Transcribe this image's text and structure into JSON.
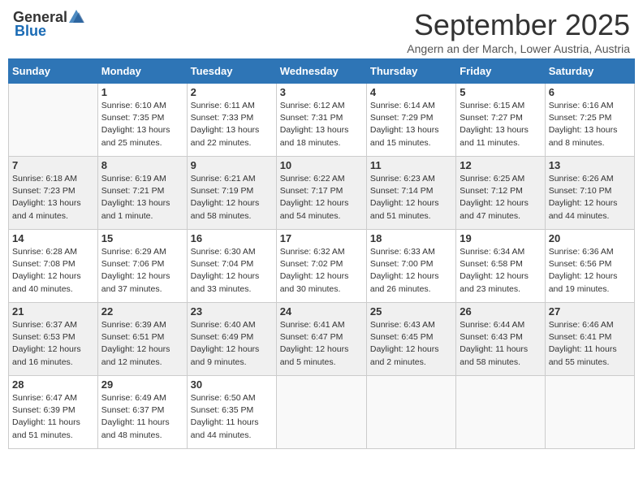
{
  "logo": {
    "general": "General",
    "blue": "Blue"
  },
  "title": "September 2025",
  "subtitle": "Angern an der March, Lower Austria, Austria",
  "days_of_week": [
    "Sunday",
    "Monday",
    "Tuesday",
    "Wednesday",
    "Thursday",
    "Friday",
    "Saturday"
  ],
  "weeks": [
    [
      {
        "day": "",
        "info": ""
      },
      {
        "day": "1",
        "info": "Sunrise: 6:10 AM\nSunset: 7:35 PM\nDaylight: 13 hours\nand 25 minutes."
      },
      {
        "day": "2",
        "info": "Sunrise: 6:11 AM\nSunset: 7:33 PM\nDaylight: 13 hours\nand 22 minutes."
      },
      {
        "day": "3",
        "info": "Sunrise: 6:12 AM\nSunset: 7:31 PM\nDaylight: 13 hours\nand 18 minutes."
      },
      {
        "day": "4",
        "info": "Sunrise: 6:14 AM\nSunset: 7:29 PM\nDaylight: 13 hours\nand 15 minutes."
      },
      {
        "day": "5",
        "info": "Sunrise: 6:15 AM\nSunset: 7:27 PM\nDaylight: 13 hours\nand 11 minutes."
      },
      {
        "day": "6",
        "info": "Sunrise: 6:16 AM\nSunset: 7:25 PM\nDaylight: 13 hours\nand 8 minutes."
      }
    ],
    [
      {
        "day": "7",
        "info": "Sunrise: 6:18 AM\nSunset: 7:23 PM\nDaylight: 13 hours\nand 4 minutes."
      },
      {
        "day": "8",
        "info": "Sunrise: 6:19 AM\nSunset: 7:21 PM\nDaylight: 13 hours\nand 1 minute."
      },
      {
        "day": "9",
        "info": "Sunrise: 6:21 AM\nSunset: 7:19 PM\nDaylight: 12 hours\nand 58 minutes."
      },
      {
        "day": "10",
        "info": "Sunrise: 6:22 AM\nSunset: 7:17 PM\nDaylight: 12 hours\nand 54 minutes."
      },
      {
        "day": "11",
        "info": "Sunrise: 6:23 AM\nSunset: 7:14 PM\nDaylight: 12 hours\nand 51 minutes."
      },
      {
        "day": "12",
        "info": "Sunrise: 6:25 AM\nSunset: 7:12 PM\nDaylight: 12 hours\nand 47 minutes."
      },
      {
        "day": "13",
        "info": "Sunrise: 6:26 AM\nSunset: 7:10 PM\nDaylight: 12 hours\nand 44 minutes."
      }
    ],
    [
      {
        "day": "14",
        "info": "Sunrise: 6:28 AM\nSunset: 7:08 PM\nDaylight: 12 hours\nand 40 minutes."
      },
      {
        "day": "15",
        "info": "Sunrise: 6:29 AM\nSunset: 7:06 PM\nDaylight: 12 hours\nand 37 minutes."
      },
      {
        "day": "16",
        "info": "Sunrise: 6:30 AM\nSunset: 7:04 PM\nDaylight: 12 hours\nand 33 minutes."
      },
      {
        "day": "17",
        "info": "Sunrise: 6:32 AM\nSunset: 7:02 PM\nDaylight: 12 hours\nand 30 minutes."
      },
      {
        "day": "18",
        "info": "Sunrise: 6:33 AM\nSunset: 7:00 PM\nDaylight: 12 hours\nand 26 minutes."
      },
      {
        "day": "19",
        "info": "Sunrise: 6:34 AM\nSunset: 6:58 PM\nDaylight: 12 hours\nand 23 minutes."
      },
      {
        "day": "20",
        "info": "Sunrise: 6:36 AM\nSunset: 6:56 PM\nDaylight: 12 hours\nand 19 minutes."
      }
    ],
    [
      {
        "day": "21",
        "info": "Sunrise: 6:37 AM\nSunset: 6:53 PM\nDaylight: 12 hours\nand 16 minutes."
      },
      {
        "day": "22",
        "info": "Sunrise: 6:39 AM\nSunset: 6:51 PM\nDaylight: 12 hours\nand 12 minutes."
      },
      {
        "day": "23",
        "info": "Sunrise: 6:40 AM\nSunset: 6:49 PM\nDaylight: 12 hours\nand 9 minutes."
      },
      {
        "day": "24",
        "info": "Sunrise: 6:41 AM\nSunset: 6:47 PM\nDaylight: 12 hours\nand 5 minutes."
      },
      {
        "day": "25",
        "info": "Sunrise: 6:43 AM\nSunset: 6:45 PM\nDaylight: 12 hours\nand 2 minutes."
      },
      {
        "day": "26",
        "info": "Sunrise: 6:44 AM\nSunset: 6:43 PM\nDaylight: 11 hours\nand 58 minutes."
      },
      {
        "day": "27",
        "info": "Sunrise: 6:46 AM\nSunset: 6:41 PM\nDaylight: 11 hours\nand 55 minutes."
      }
    ],
    [
      {
        "day": "28",
        "info": "Sunrise: 6:47 AM\nSunset: 6:39 PM\nDaylight: 11 hours\nand 51 minutes."
      },
      {
        "day": "29",
        "info": "Sunrise: 6:49 AM\nSunset: 6:37 PM\nDaylight: 11 hours\nand 48 minutes."
      },
      {
        "day": "30",
        "info": "Sunrise: 6:50 AM\nSunset: 6:35 PM\nDaylight: 11 hours\nand 44 minutes."
      },
      {
        "day": "",
        "info": ""
      },
      {
        "day": "",
        "info": ""
      },
      {
        "day": "",
        "info": ""
      },
      {
        "day": "",
        "info": ""
      }
    ]
  ]
}
